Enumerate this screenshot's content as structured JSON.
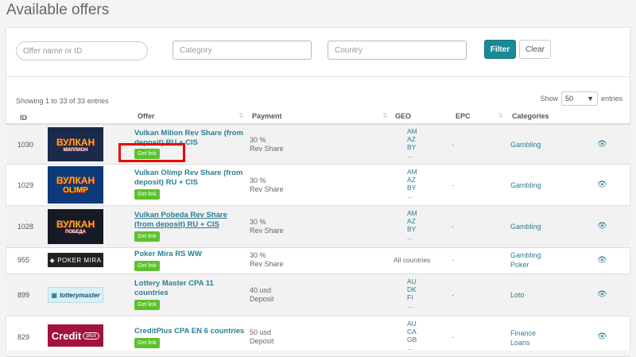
{
  "page_title": "Available offers",
  "filters": {
    "offer_placeholder": "Offer name or ID",
    "category_placeholder": "Category",
    "country_placeholder": "Country",
    "filter_label": "Filter",
    "clear_label": "Clear"
  },
  "table_info": {
    "showing": "Showing 1 to 33 of 33 entries",
    "show_label": "Show",
    "page_size": "50",
    "entries_label": "entries"
  },
  "columns": [
    "ID",
    "Offer",
    "Payment",
    "GEO",
    "EPC",
    "Categories"
  ],
  "get_link_label": "Get link",
  "colors": {
    "accent": "#1a8a96",
    "link": "#2a7e94",
    "get_link": "#5cc12c",
    "highlight": "#e00000"
  },
  "rows": [
    {
      "id": "1030",
      "logo_text": "ВУЛКАН",
      "logo_sub": "МИЛЛИОН",
      "name_line1": "Vulkan Milion Rev Share (from",
      "name_line2": "deposit) RU + CIS",
      "pay_amount": "30 %",
      "pay_type": "Rev Share",
      "geo": [
        "AM",
        "AZ",
        "BY",
        "..."
      ],
      "epc": "-",
      "categories": [
        "Gambling"
      ]
    },
    {
      "id": "1029",
      "logo_text": "ВУЛКАН",
      "logo_sub": "OLIMP",
      "name_line1": "Vulkan Olimp Rev Share (from",
      "name_line2": "deposit) RU + CIS",
      "pay_amount": "30 %",
      "pay_type": "Rev Share",
      "geo": [
        "AM",
        "AZ",
        "BY",
        "..."
      ],
      "epc": "-",
      "categories": [
        "Gambling"
      ]
    },
    {
      "id": "1028",
      "logo_text": "ВУЛКАН",
      "logo_sub": "ПОБЕДА",
      "name_line1": "Vulkan Pobeda Rev Share",
      "name_line2": "(from deposit) RU + CIS",
      "pay_amount": "30 %",
      "pay_type": "Rev Share",
      "geo": [
        "AM",
        "AZ",
        "BY",
        "..."
      ],
      "epc": "-",
      "categories": [
        "Gambling"
      ]
    },
    {
      "id": "955",
      "logo_text": "POKER MIRA",
      "logo_sub": "",
      "name_line1": "Poker Mira RS WW",
      "name_line2": "",
      "pay_amount": "30 %",
      "pay_type": "Rev Share",
      "geo_all": "All countries",
      "epc": "-",
      "categories": [
        "Gambling",
        "Poker"
      ]
    },
    {
      "id": "899",
      "logo_text": "lotterymaster",
      "logo_sub": "",
      "name_line1": "Lottery Master CPA 11",
      "name_line2": "countries",
      "pay_amount": "40 usd",
      "pay_type": "Deposit",
      "geo": [
        "AU",
        "DK",
        "FI",
        "..."
      ],
      "epc": "-",
      "categories": [
        "Loto"
      ]
    },
    {
      "id": "829",
      "logo_text": "Credit",
      "logo_sub": "plus",
      "name_line1": "CreditPlus CPA EN 6 countries",
      "name_line2": "",
      "pay_amount": "50 usd",
      "pay_type": "Deposit",
      "geo": [
        "AU",
        "CA",
        "GB",
        "..."
      ],
      "epc": "-",
      "categories": [
        "Finance",
        "Loans"
      ]
    }
  ]
}
